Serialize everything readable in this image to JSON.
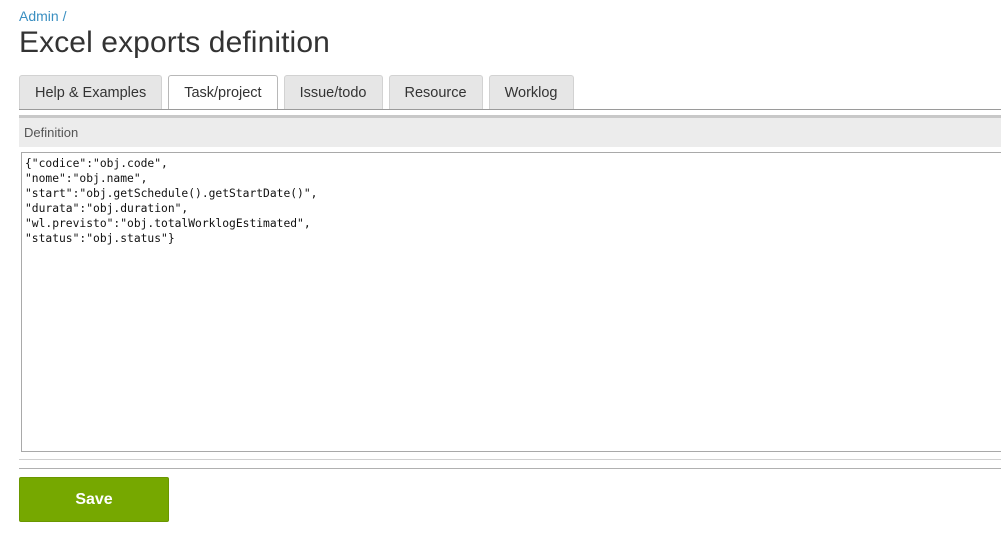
{
  "breadcrumb": {
    "label": "Admin /"
  },
  "page": {
    "title": "Excel exports definition"
  },
  "tabs": [
    {
      "label": "Help & Examples",
      "active": false
    },
    {
      "label": "Task/project",
      "active": true
    },
    {
      "label": "Issue/todo",
      "active": false
    },
    {
      "label": "Resource",
      "active": false
    },
    {
      "label": "Worklog",
      "active": false
    }
  ],
  "definition": {
    "header": "Definition",
    "value": "{\"codice\":\"obj.code\",\n\"nome\":\"obj.name\",\n\"start\":\"obj.getSchedule().getStartDate()\",\n\"durata\":\"obj.duration\",\n\"wl.previsto\":\"obj.totalWorklogEstimated\",\n\"status\":\"obj.status\"}"
  },
  "actions": {
    "save_label": "Save",
    "save_color": "#76a800"
  },
  "colors": {
    "link": "#3a8fc1",
    "title": "#333333",
    "tab_bg": "#e6e6e6",
    "header_bg": "#ececec"
  }
}
